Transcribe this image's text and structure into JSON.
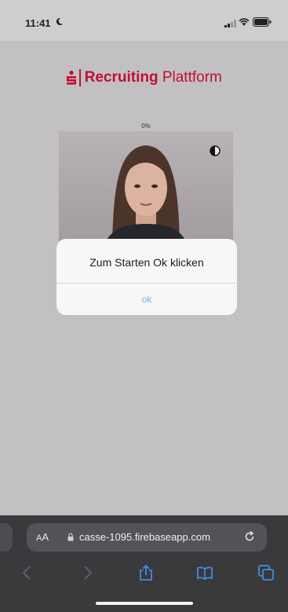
{
  "status_bar": {
    "time": "11:41"
  },
  "brand": {
    "bold": "Recruiting",
    "regular": " Plattform",
    "color": "#c0102f"
  },
  "video": {
    "progress": "0%"
  },
  "dialog": {
    "message": "Zum Starten Ok klicken",
    "ok_label": "ok"
  },
  "browser": {
    "text_size_label_small": "A",
    "text_size_label_large": "A",
    "url": "casse-1095.firebaseapp.com"
  }
}
